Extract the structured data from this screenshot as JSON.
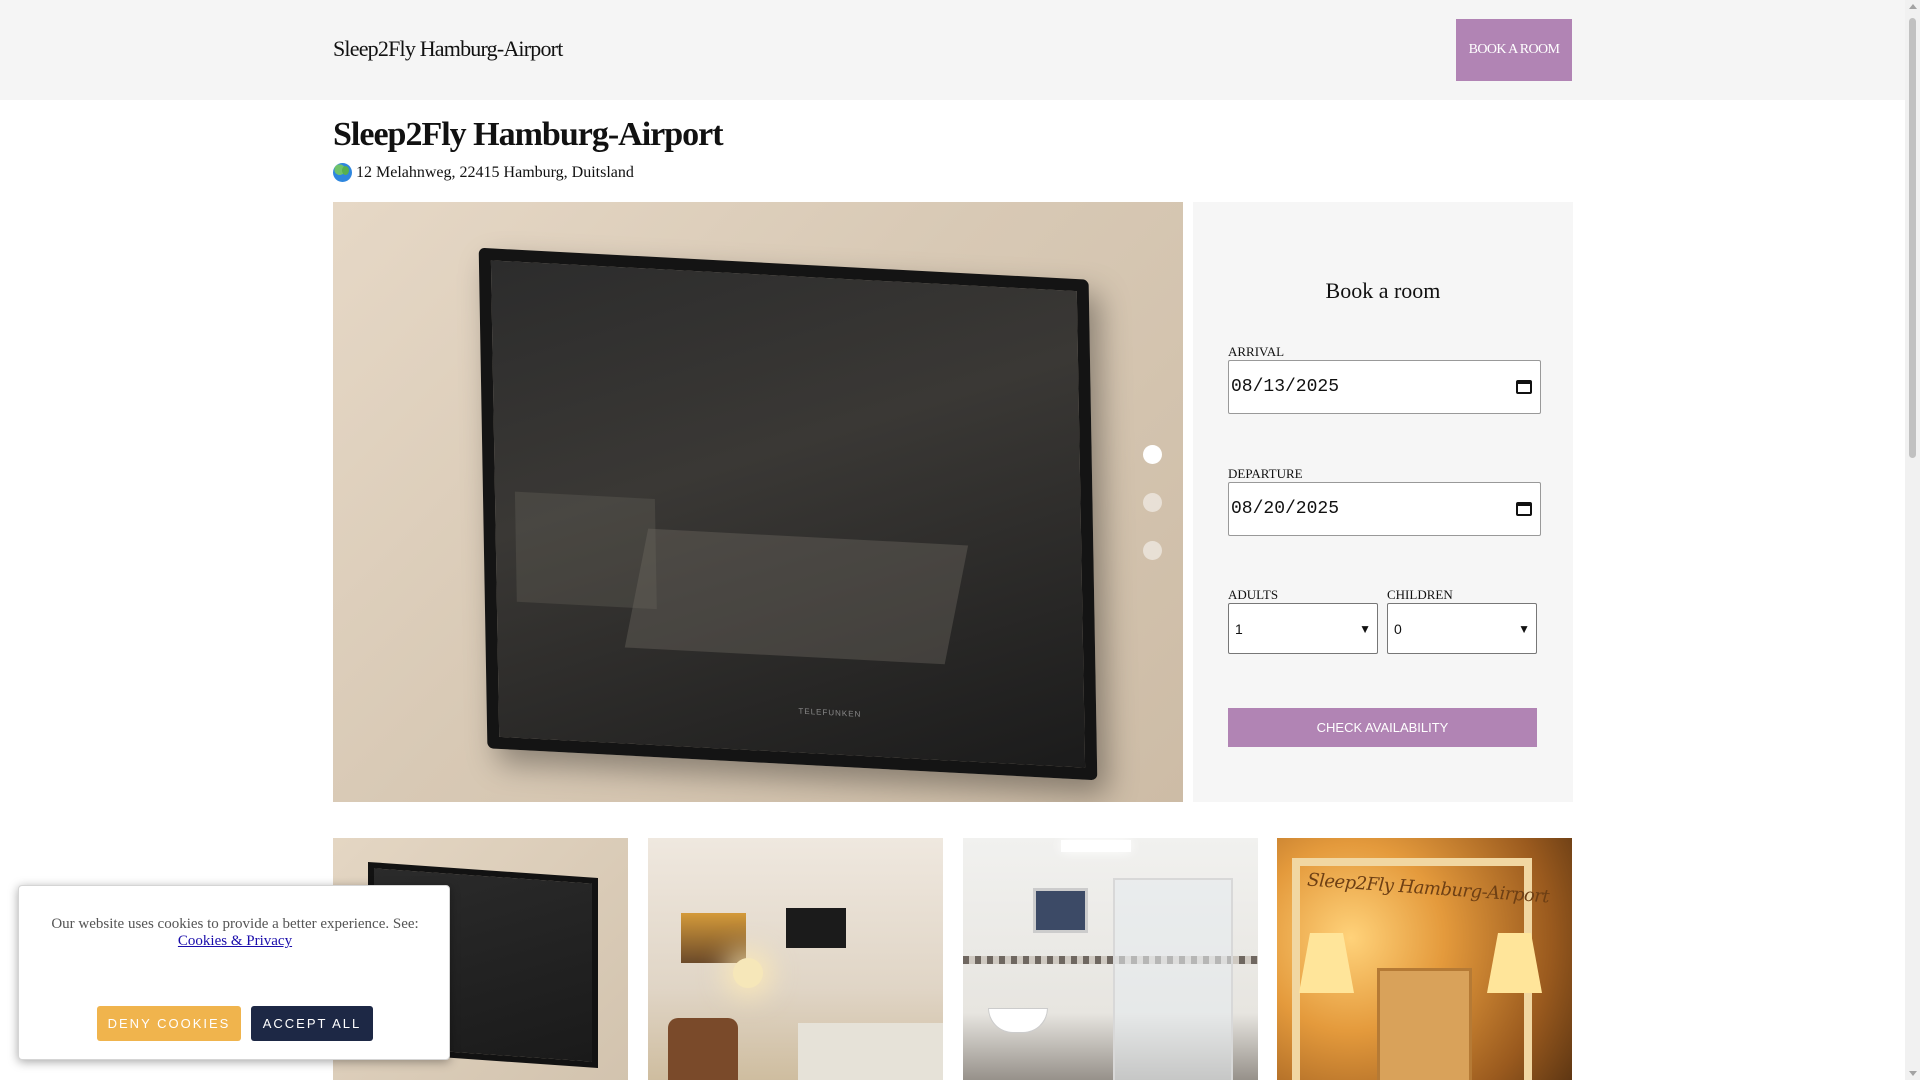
{
  "header": {
    "brand": "Sleep2Fly Hamburg-Airport",
    "book_button": "BOOK A ROOM"
  },
  "hotel": {
    "title": "Sleep2Fly Hamburg-Airport",
    "address": "12 Melahnweg, 22415 Hamburg, Duitsland",
    "address_icon": "globe-icon"
  },
  "gallery": {
    "active_slide": 1,
    "slide_count": 3,
    "tv_brand": "TELEFUNKEN",
    "thumbnail_sign": "Sleep2Fly Hamburg-Airport"
  },
  "booking": {
    "title": "Book a room",
    "arrival_label": "ARRIVAL",
    "arrival_value": "08/13/2025",
    "departure_label": "DEPARTURE",
    "departure_value": "08/20/2025",
    "adults_label": "ADULTS",
    "adults_value": "1",
    "children_label": "CHILDREN",
    "children_value": "0",
    "check_button": "CHECK AVAILABILITY"
  },
  "cookie_banner": {
    "text": "Our website uses cookies to provide a better experience. See:",
    "link": "Cookies & Privacy",
    "deny": "DENY COOKIES",
    "accept": "ACCEPT ALL"
  },
  "colors": {
    "accent": "#b184b4",
    "deny": "#f0b44d",
    "accept": "#1d2845"
  }
}
